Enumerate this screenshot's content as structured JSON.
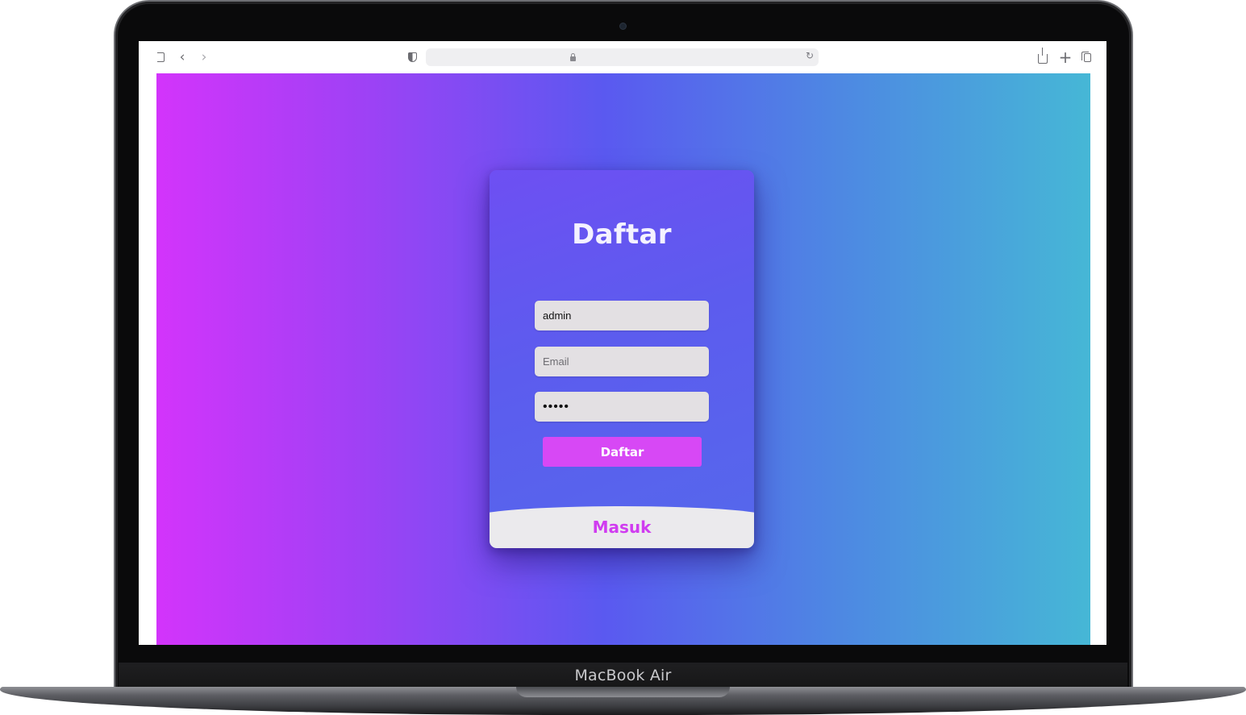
{
  "device": {
    "label": "MacBook Air"
  },
  "browser": {
    "toolbar": {
      "back_icon": "‹",
      "forward_icon": "›",
      "reload_icon": "↻",
      "newtab_icon": "+"
    }
  },
  "page": {
    "background_gradient": [
      "#d334fb",
      "#9f41f5",
      "#5a59f0",
      "#4e86e3",
      "#46b7d6"
    ],
    "card": {
      "title": "Daftar",
      "username_value": "admin",
      "email_placeholder": "Email",
      "password_value": "12345",
      "submit_label": "Daftar",
      "login_link": "Masuk",
      "accent_color": "#d748f5"
    }
  }
}
